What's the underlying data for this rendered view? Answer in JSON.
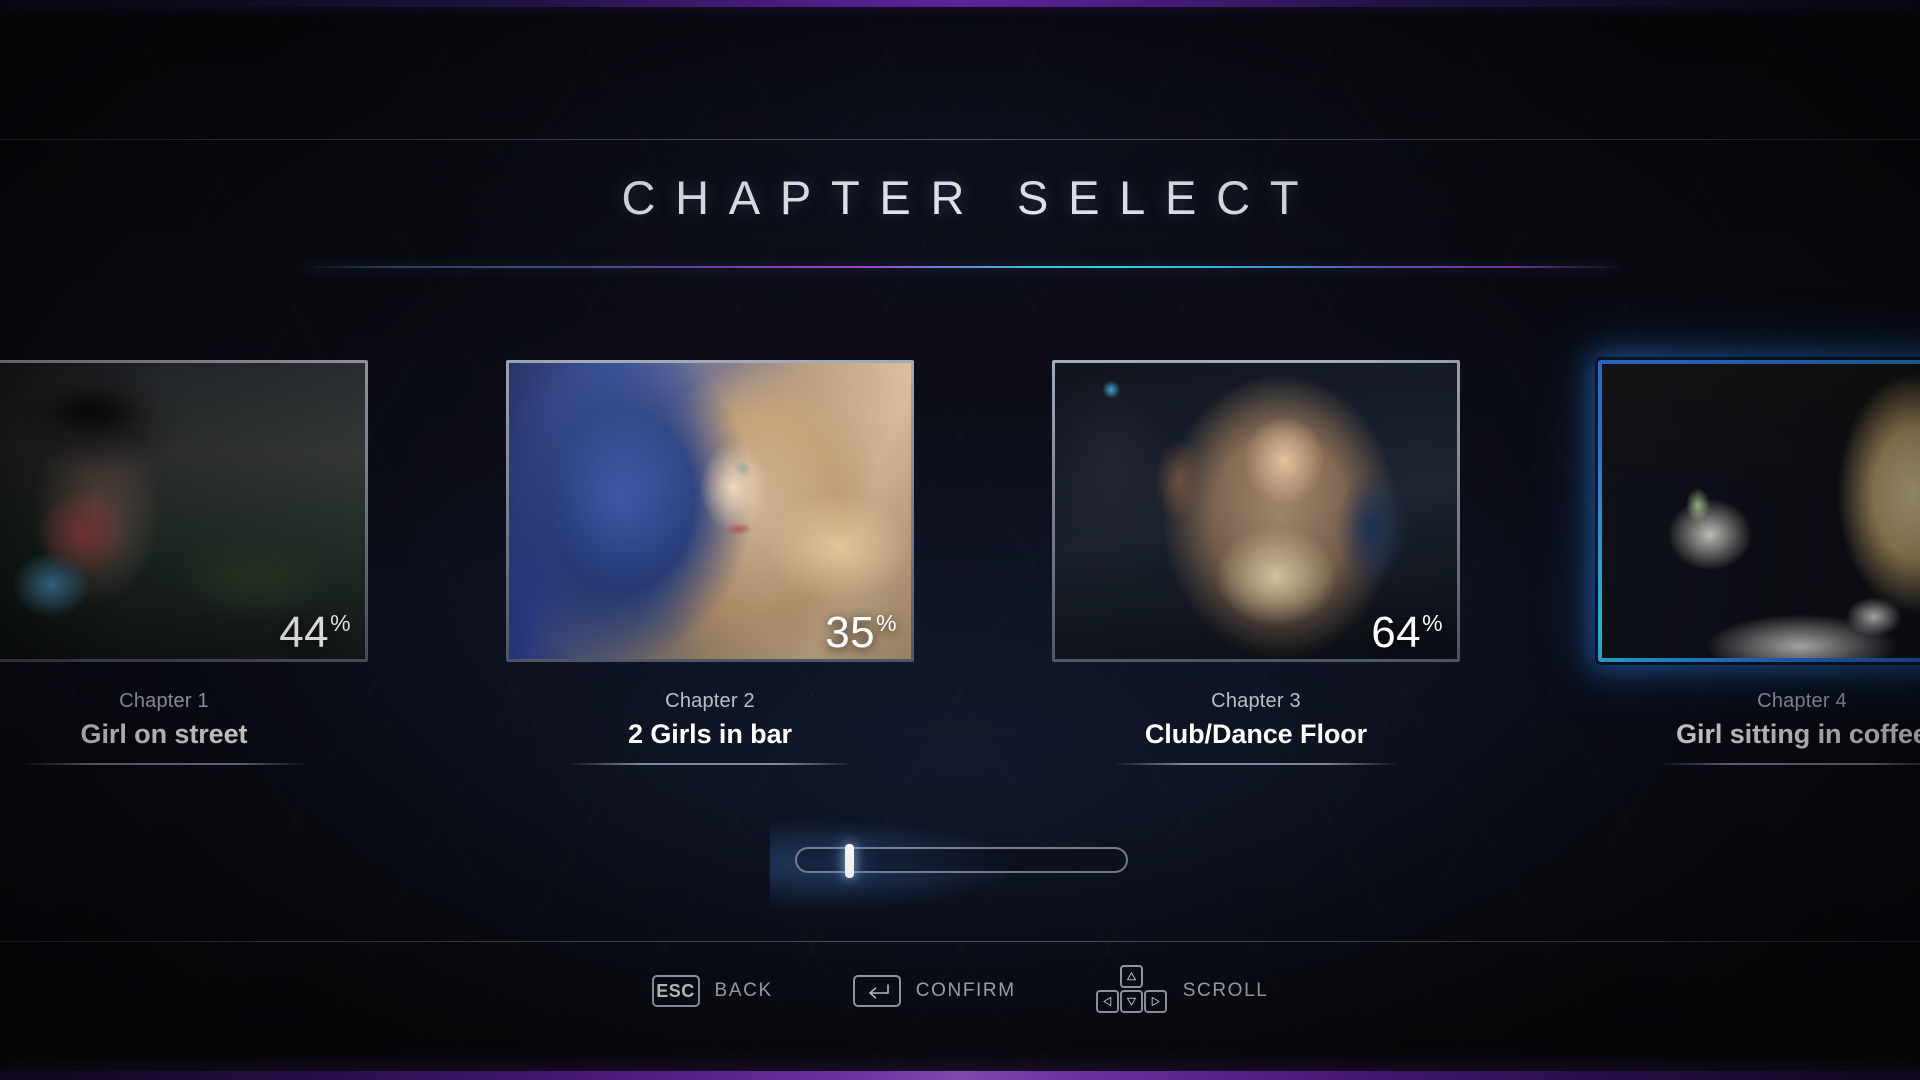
{
  "header": {
    "title": "CHAPTER SELECT"
  },
  "carousel": {
    "chapters": [
      {
        "number_label": "Chapter 1",
        "title": "Girl on street",
        "percent": "44",
        "percent_symbol": "%",
        "selected": false,
        "art": "art-street",
        "thumb_name": "chapter-1-thumbnail"
      },
      {
        "number_label": "Chapter 2",
        "title": "2 Girls in bar",
        "percent": "35",
        "percent_symbol": "%",
        "selected": false,
        "art": "art-blonde",
        "thumb_name": "chapter-2-thumbnail"
      },
      {
        "number_label": "Chapter 3",
        "title": "Club/Dance Floor",
        "percent": "64",
        "percent_symbol": "%",
        "selected": false,
        "art": "art-club",
        "thumb_name": "chapter-3-thumbnail"
      },
      {
        "number_label": "Chapter 4",
        "title": "Girl sitting in coffee",
        "percent": "",
        "percent_symbol": "",
        "selected": true,
        "art": "art-coffee",
        "thumb_name": "chapter-4-thumbnail"
      }
    ]
  },
  "scrollbar": {
    "thumb_position_percent": 15
  },
  "footer": {
    "hints": [
      {
        "key_label": "ESC",
        "action_label": "BACK",
        "key_type": "esc"
      },
      {
        "key_label": "Enter",
        "action_label": "CONFIRM",
        "key_type": "enter"
      },
      {
        "key_label": "Arrows",
        "action_label": "SCROLL",
        "key_type": "dpad"
      }
    ]
  },
  "colors": {
    "accent_selected": "#2f8cf0",
    "accent_cyan": "#2fd2e6",
    "accent_purple": "#a445ee",
    "background": "#0a0b12",
    "text_primary": "#ffffff",
    "text_secondary": "#b9c0cc"
  }
}
